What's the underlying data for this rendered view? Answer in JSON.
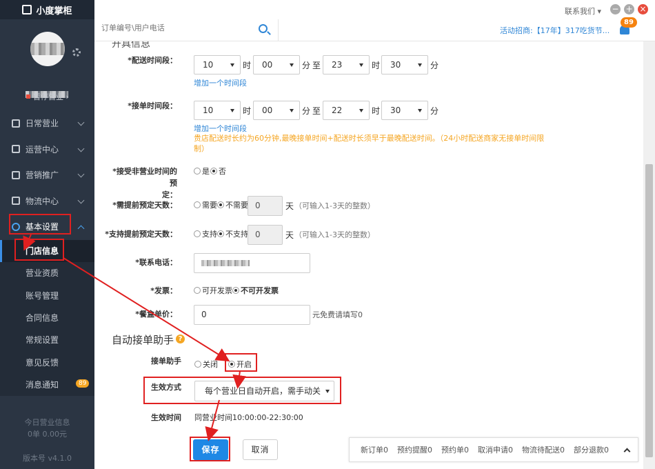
{
  "app": {
    "logo_text": "小度掌柜"
  },
  "topbar": {
    "contact": "联系我们 ▾",
    "min": "−",
    "max": "+",
    "close": "×"
  },
  "search": {
    "placeholder": "订单编号\\用户电话",
    "notice": "活动招商:【17年】317吃货节...",
    "bell_badge": "89"
  },
  "sidebar": {
    "pause_label": "暂停营业 ›",
    "menu": [
      {
        "label": "日常营业"
      },
      {
        "label": "运营中心"
      },
      {
        "label": "营销推广"
      },
      {
        "label": "物流中心"
      },
      {
        "label": "基本设置"
      }
    ],
    "sub_items": [
      {
        "label": "门店信息"
      },
      {
        "label": "营业资质"
      },
      {
        "label": "账号管理"
      },
      {
        "label": "合同信息"
      },
      {
        "label": "常规设置"
      },
      {
        "label": "意见反馈"
      },
      {
        "label": "消息通知",
        "badge": "89"
      }
    ],
    "today_title": "今日营业信息",
    "today_value": "0单 0.00元",
    "version": "版本号 v4.1.0"
  },
  "form": {
    "section_partial": "开具信息",
    "delivery": {
      "label": "*配送时间段：",
      "start_hour": "10",
      "start_min": "00",
      "end_hour": "23",
      "end_min": "30",
      "hour_unit": "时",
      "min_unit": "分",
      "to": "至",
      "add_link": "增加一个时间段"
    },
    "accept": {
      "label": "*接单时间段：",
      "start_hour": "10",
      "start_min": "00",
      "end_hour": "22",
      "end_min": "30",
      "add_link": "增加一个时间段",
      "warning": "贵店配送时长约为60分钟,最晚接单时间+配送时长须早于最晚配送时间。（24小时配送商家无接单时间限制）"
    },
    "preorder_offhours": {
      "label_line1": "*接受非营业时间的预",
      "label_line2": "定：",
      "yes": "是",
      "no": "否"
    },
    "advance_days": {
      "label": "*需提前预定天数：",
      "need": "需要",
      "no_need": "不需要",
      "value": "0",
      "unit": "天",
      "hint": "（可输入1-3天的整数）"
    },
    "support_days": {
      "label": "*支持提前预定天数：",
      "support": "支持",
      "no_support": "不支持",
      "value": "0",
      "unit": "天",
      "hint": "（可输入1-3天的整数）"
    },
    "phone": {
      "label": "*联系电话："
    },
    "invoice": {
      "label": "*发票：",
      "can": "可开发票",
      "cannot": "不可开发票"
    },
    "meal_price": {
      "label": "*餐盒单价：",
      "value": "0",
      "hint": "元免费请填写0"
    }
  },
  "auto_accept": {
    "title": "自动接单助手",
    "help": "?",
    "assistant_label": "接单助手",
    "off": "关闭",
    "on": "开启",
    "mode_label": "生效方式",
    "mode_value": "每个营业日自动开启，需手动关",
    "time_label": "生效时间",
    "time_value": "同营业时间10:00:00-22:30:00"
  },
  "buttons": {
    "save": "保存",
    "cancel": "取消"
  },
  "statusbar": {
    "items": [
      "新订单0",
      "预约提醒0",
      "预约单0",
      "取消申请0",
      "物流待配送0",
      "部分退款0"
    ]
  },
  "colors": {
    "accent": "#1e88e5",
    "sidebar_bg": "#2b3543",
    "annotation_red": "#e02020",
    "warning": "#f5a623"
  }
}
